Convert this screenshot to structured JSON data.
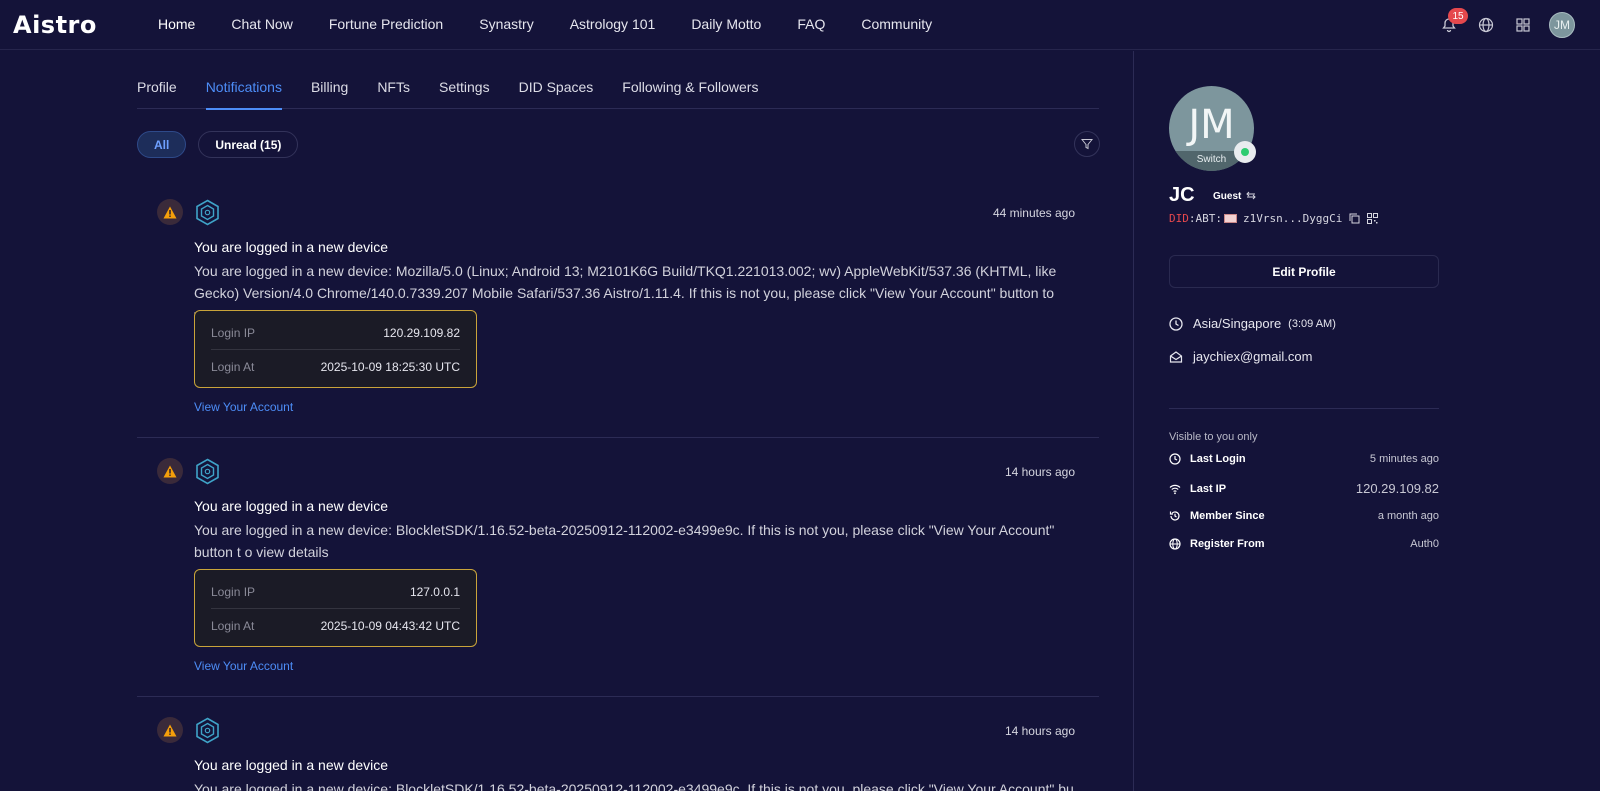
{
  "app": {
    "logo": "Aistro"
  },
  "nav": {
    "items": [
      "Home",
      "Chat Now",
      "Fortune Prediction",
      "Synastry",
      "Astrology 101",
      "Daily Motto",
      "FAQ",
      "Community"
    ],
    "active": "Home"
  },
  "topbar": {
    "notification_count": "15",
    "avatar_initials": "JM"
  },
  "tabs": {
    "items": [
      "Profile",
      "Notifications",
      "Billing",
      "NFTs",
      "Settings",
      "DID Spaces",
      "Following & Followers"
    ],
    "active": "Notifications"
  },
  "filters": {
    "all": "All",
    "unread": "Unread (15)"
  },
  "notifications": [
    {
      "time": "44 minutes ago",
      "title": "You are logged in a new device",
      "body": "You are logged in a new device: Mozilla/5.0 (Linux; Android 13; M2101K6G Build/TKQ1.221013.002; wv) AppleWebKit/537.36 (KHTML, like Gecko) Version/4.0 Chrome/140.0.7339.207 Mobile Safari/537.36 Aistro/1.11.4. If this is not you, please click \"View Your Account\" button to view details",
      "ip_label": "Login IP",
      "ip": "120.29.109.82",
      "at_label": "Login At",
      "at": "2025-10-09 18:25:30 UTC",
      "link": "View Your Account"
    },
    {
      "time": "14 hours ago",
      "title": "You are logged in a new device",
      "body": "You are logged in a new device: BlockletSDK/1.16.52-beta-20250912-112002-e3499e9c. If this is not you, please click \"View Your Account\" button t o view details",
      "ip_label": "Login IP",
      "ip": "127.0.0.1",
      "at_label": "Login At",
      "at": "2025-10-09 04:43:42 UTC",
      "link": "View Your Account"
    },
    {
      "time": "14 hours ago",
      "title": "You are logged in a new device",
      "body": "You are logged in a new device: BlockletSDK/1.16.52-beta-20250912-112002-e3499e9c. If this is not you, please click \"View Your Account\" button t"
    }
  ],
  "profile": {
    "avatar_initials": "JM",
    "switch_label": "Switch",
    "name": "JC",
    "role": "Guest",
    "did_prefix": "DID",
    "did_abt": ":ABT:",
    "did_value": "z1Vrsn...DyggCi",
    "edit_button": "Edit Profile",
    "timezone": "Asia/Singapore",
    "local_time": "(3:09 AM)",
    "email": "jaychiex@gmail.com",
    "visible_label": "Visible to you only",
    "stats": [
      {
        "label": "Last Login",
        "value": "5 minutes ago"
      },
      {
        "label": "Last IP",
        "value": "120.29.109.82"
      },
      {
        "label": "Member Since",
        "value": "a month ago"
      },
      {
        "label": "Register From",
        "value": "Auth0"
      }
    ]
  },
  "colors": {
    "background": "#141339",
    "accent": "#4d8df7",
    "warning": "#f59f0a",
    "box_border": "#c9a43a",
    "badge": "#e5484d",
    "online": "#2ecc71"
  }
}
